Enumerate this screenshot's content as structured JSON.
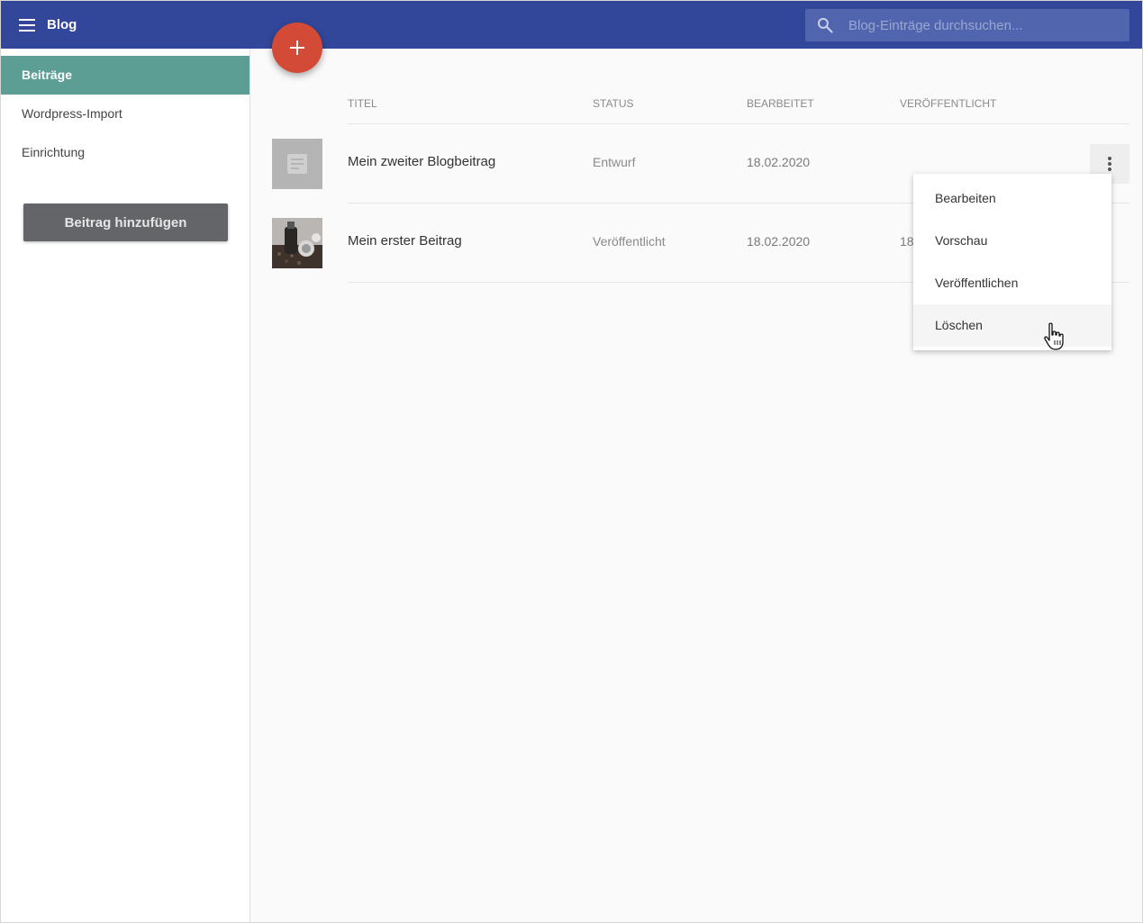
{
  "header": {
    "title": "Blog",
    "search_placeholder": "Blog-Einträge durchsuchen...",
    "bg_color": "#32479a"
  },
  "sidebar": {
    "items": [
      {
        "label": "Beiträge",
        "active": true
      },
      {
        "label": "Wordpress-Import",
        "active": false
      },
      {
        "label": "Einrichtung",
        "active": false
      }
    ],
    "add_button_label": "Beitrag hinzufügen",
    "active_color": "#5c9e93"
  },
  "table": {
    "columns": [
      "TITEL",
      "STATUS",
      "BEARBEITET",
      "VERÖFFENTLICHT"
    ],
    "rows": [
      {
        "title": "Mein zweiter Blogbeitrag",
        "status": "Entwurf",
        "edited": "18.02.2020",
        "published": "",
        "thumb": "document-placeholder-icon"
      },
      {
        "title": "Mein erster Beitrag",
        "status": "Veröffentlicht",
        "edited": "18.02.2020",
        "published": "18",
        "thumb": "coffee-grinder-photo"
      }
    ]
  },
  "context_menu": {
    "items": [
      "Bearbeiten",
      "Vorschau",
      "Veröffentlichen",
      "Löschen"
    ],
    "hovered": "Löschen"
  },
  "fab": {
    "icon": "plus-icon",
    "color": "#d34b36"
  }
}
